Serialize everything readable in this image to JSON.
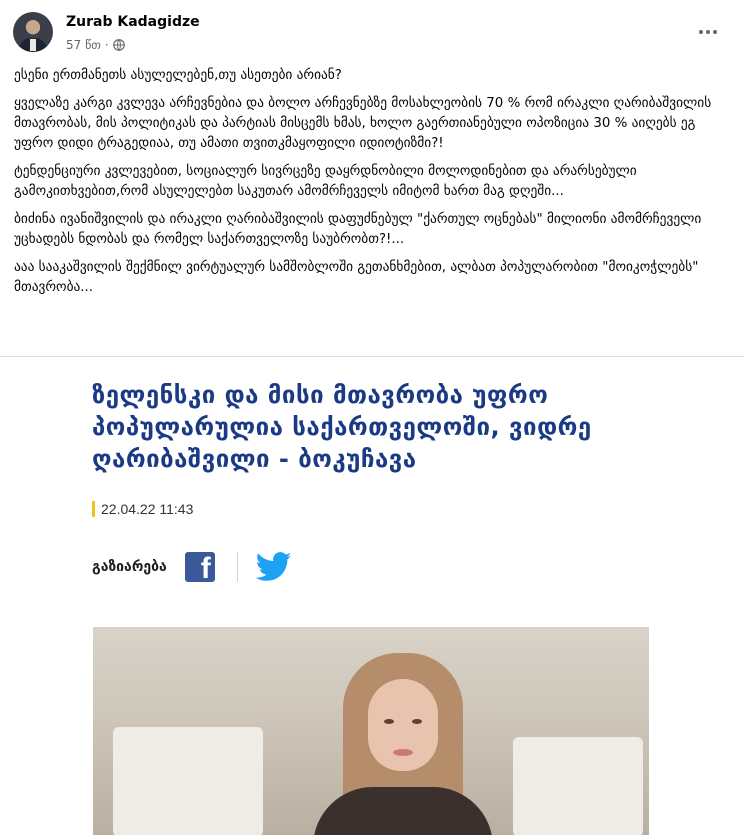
{
  "post": {
    "author": "Zurab Kadagidze",
    "time": "57 წთ",
    "separator": "·",
    "paragraphs": [
      "ესენი ერთმანეთს ასულელებენ,თუ ასეთები არიან?",
      "ყველაზე კარგი კვლევა არჩევნებია და ბოლო არჩევნებზე მოსახლეობის  70 %  რომ  ირაკლი ღარიბაშვილის მთავრობას, მის პოლიტიკას და პარტიას  მისცემს ხმას, ხოლო გაერთიანებული ოპოზიცია 30 % აიღებს ეგ უფრო დიდი ტრაგედიაა, თუ ამათი თვითკმაყოფილი იდიოტიზმი?!",
      "ტენდენციური კვლევებით, სოციალურ სივრცეზე დაყრდნობილი მოლოდინებით და არარსებული გამოკითხვებით,რომ ასულელებთ საკუთარ ამომრჩეველს იმიტომ ხართ მაგ დღეში...",
      "ბიძინა ივანიშვილის და ირაკლი ღარიბაშვილის დაფუძნებულ \"ქართულ ოცნებას\" მილიონი ამომრჩეველი უცხადებს ნდობას და რომელ საქართველოზე საუბრობთ?!...",
      "ააა სააკაშვილის შექმნილ ვირტუალურ სამშობლოში გეთანხმებით, ალბათ პოპულარობით \"მოიკოჭლებს\" მთავრობა..."
    ]
  },
  "article": {
    "headline": "ზელენსკი და მისი მთავრობა უფრო პოპულარულია საქართველოში, ვიდრე ღარიბაშვილი - ბოკუჩავა",
    "date": "22.04.22 11:43",
    "share_label": "გაზიარება",
    "fb_letter": "f"
  },
  "colors": {
    "headline": "#1b3a86",
    "facebook": "#3b5998",
    "twitter": "#1da1f2",
    "date_accent": "#f1c40f"
  },
  "icons": [
    "globe-icon",
    "more-options-icon",
    "facebook-icon",
    "twitter-icon"
  ]
}
